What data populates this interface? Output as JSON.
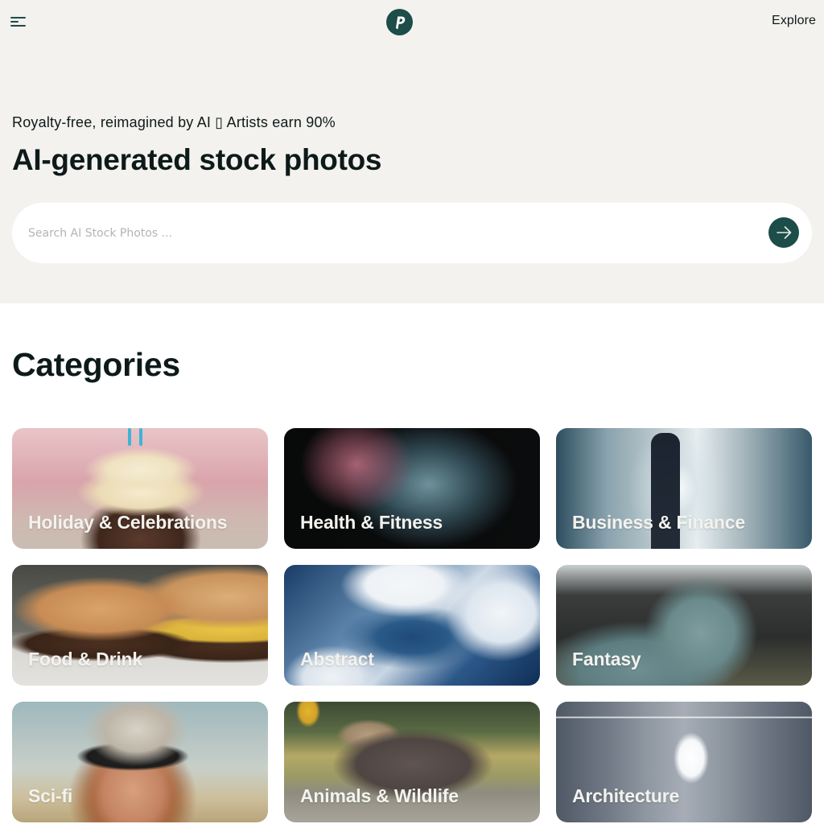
{
  "header": {
    "menu_icon": "hamburger-menu-icon",
    "logo_icon": "p-logo-icon",
    "explore_label": "Explore"
  },
  "hero": {
    "tagline": "Royalty-free, reimagined by AI ▯ Artists earn 90%",
    "headline": "AI-generated stock photos",
    "search": {
      "placeholder": "Search AI Stock Photos ...",
      "value": "",
      "submit_icon": "arrow-right-icon"
    }
  },
  "colors": {
    "brand": "#1c4d48",
    "hero_background": "#f3f2ee",
    "text": "#0e1a1a",
    "card_label": "#f3f2ee"
  },
  "categories": {
    "title": "Categories",
    "items": [
      {
        "label": "Holiday & Celebrations",
        "image": "cupcake with candles"
      },
      {
        "label": "Health & Fitness",
        "image": "x-ray skull"
      },
      {
        "label": "Business & Finance",
        "image": "businessman walking in corridor"
      },
      {
        "label": "Food & Drink",
        "image": "burgers"
      },
      {
        "label": "Abstract",
        "image": "blue marble swirls"
      },
      {
        "label": "Fantasy",
        "image": "green ogre"
      },
      {
        "label": "Sci-fi",
        "image": "girl with goggles and headphones"
      },
      {
        "label": "Animals & Wildlife",
        "image": "moose in water"
      },
      {
        "label": "Architecture",
        "image": "empty lit corridor"
      }
    ]
  }
}
